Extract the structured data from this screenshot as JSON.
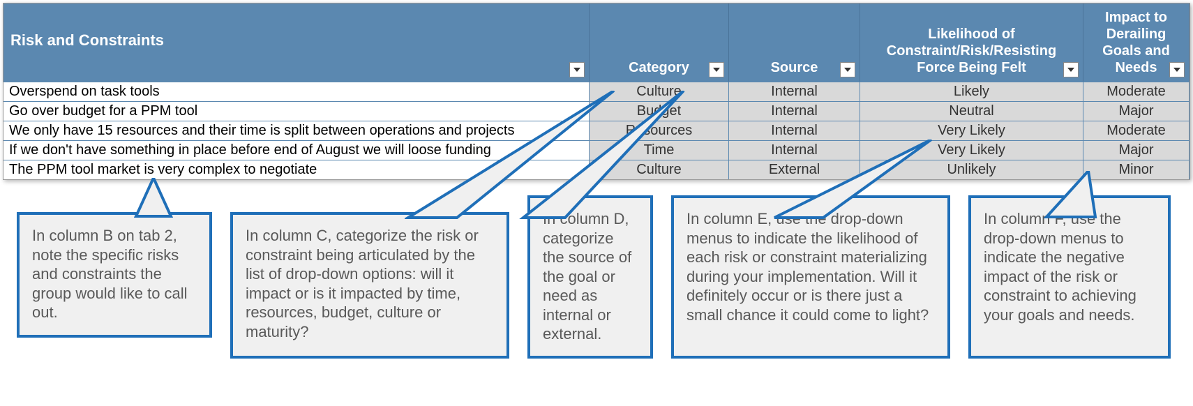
{
  "columns": {
    "risk": "Risk and Constraints",
    "category": "Category",
    "source": "Source",
    "likelihood": "Likelihood of Constraint/Risk/Resisting Force Being Felt",
    "impact": "Impact to Derailing Goals and Needs"
  },
  "rows": [
    {
      "risk": "Overspend on task tools",
      "category": "Culture",
      "source": "Internal",
      "likelihood": "Likely",
      "impact": "Moderate"
    },
    {
      "risk": "Go over budget for a PPM tool",
      "category": "Budget",
      "source": "Internal",
      "likelihood": "Neutral",
      "impact": "Major"
    },
    {
      "risk": "We only have 15 resources and their time is split between operations and projects",
      "category": "Resources",
      "source": "Internal",
      "likelihood": "Very Likely",
      "impact": "Moderate"
    },
    {
      "risk": "If we don't have something in place before end of August we will loose funding",
      "category": "Time",
      "source": "Internal",
      "likelihood": "Very Likely",
      "impact": "Major"
    },
    {
      "risk": "The PPM tool market is very complex to negotiate",
      "category": "Culture",
      "source": "External",
      "likelihood": "Unlikely",
      "impact": "Minor"
    }
  ],
  "callouts": {
    "b": "In column B on tab 2, note the specific risks and constraints the group would like to call out.",
    "c": "In column C, categorize the risk or constraint being articulated by the list of drop-down options: will it impact or is it impacted by time, resources, budget, culture or maturity?",
    "d": "In column D, categorize the source of the goal or need as internal or external.",
    "e": "In column E, use the drop-down menus to indicate the likelihood of each risk or constraint materializing during your implementation. Will it definitely occur or is there just a small chance it could come to light?",
    "f": "In column F, use the drop-down menus to indicate the negative impact of the risk or constraint to achieving your goals and needs."
  }
}
